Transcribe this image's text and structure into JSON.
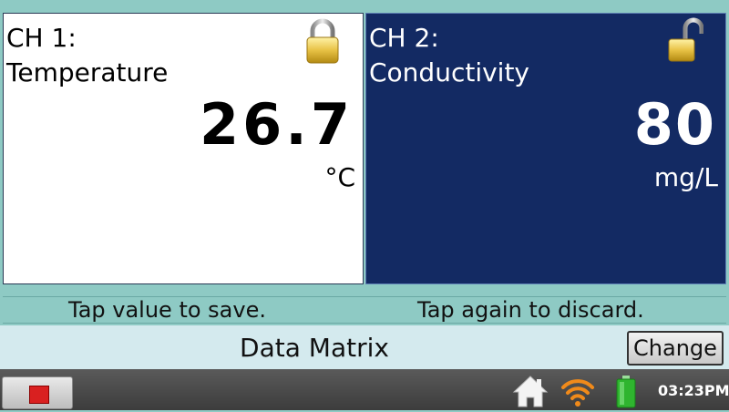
{
  "channels": [
    {
      "label_line1": "CH 1:",
      "label_line2": "Temperature",
      "value": "26.7",
      "unit": "°C",
      "lock_state": "locked",
      "lock_icon": "padlock-locked-icon",
      "background": "#ffffff"
    },
    {
      "label_line1": "CH 2:",
      "label_line2": "Conductivity",
      "value": "80",
      "unit": "mg/L",
      "lock_state": "unlocked",
      "lock_icon": "padlock-unlocked-icon",
      "background": "#132a63"
    }
  ],
  "hints": {
    "left": "Tap value to save.",
    "right": "Tap again to discard."
  },
  "mode": {
    "title": "Data Matrix",
    "change_label": "Change"
  },
  "taskbar": {
    "stop_icon": "stop-icon",
    "home_icon": "home-icon",
    "wifi_icon": "wifi-icon",
    "battery_icon": "battery-icon",
    "clock": "03:23PM"
  },
  "colors": {
    "accent_teal": "#8ecac4",
    "panel_blue": "#132a63",
    "stop_red": "#d92020",
    "wifi_orange": "#f08a1a",
    "battery_green": "#2fb52f"
  }
}
